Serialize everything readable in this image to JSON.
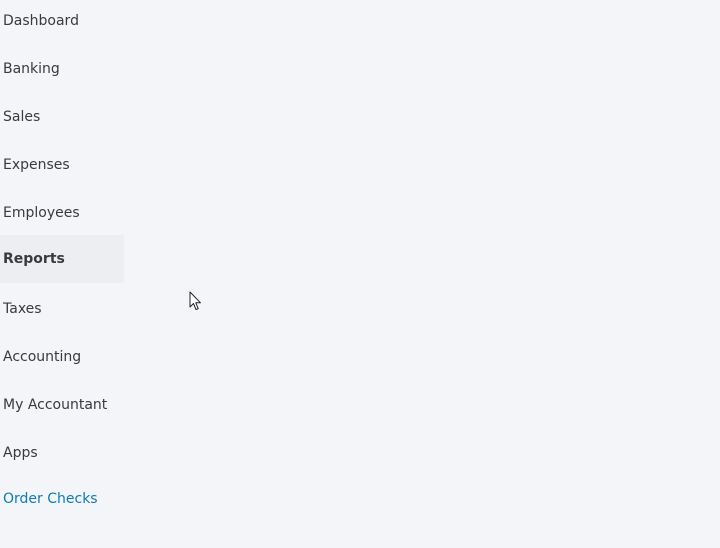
{
  "sidebar": {
    "items": [
      {
        "label": "Dashboard",
        "active": false
      },
      {
        "label": "Banking",
        "active": false
      },
      {
        "label": "Sales",
        "active": false
      },
      {
        "label": "Expenses",
        "active": false
      },
      {
        "label": "Employees",
        "active": false
      },
      {
        "label": "Reports",
        "active": true
      },
      {
        "label": "Taxes",
        "active": false
      },
      {
        "label": "Accounting",
        "active": false
      },
      {
        "label": "My Accountant",
        "active": false
      },
      {
        "label": "Apps",
        "active": false
      }
    ],
    "order_checks_label": "Order Checks"
  },
  "colors": {
    "background": "#f4f5f8",
    "active_item_bg": "#eceef1",
    "text": "#393a3d",
    "link": "#0d7cb6"
  },
  "icons": {
    "cursor": "mouse-pointer-icon"
  }
}
